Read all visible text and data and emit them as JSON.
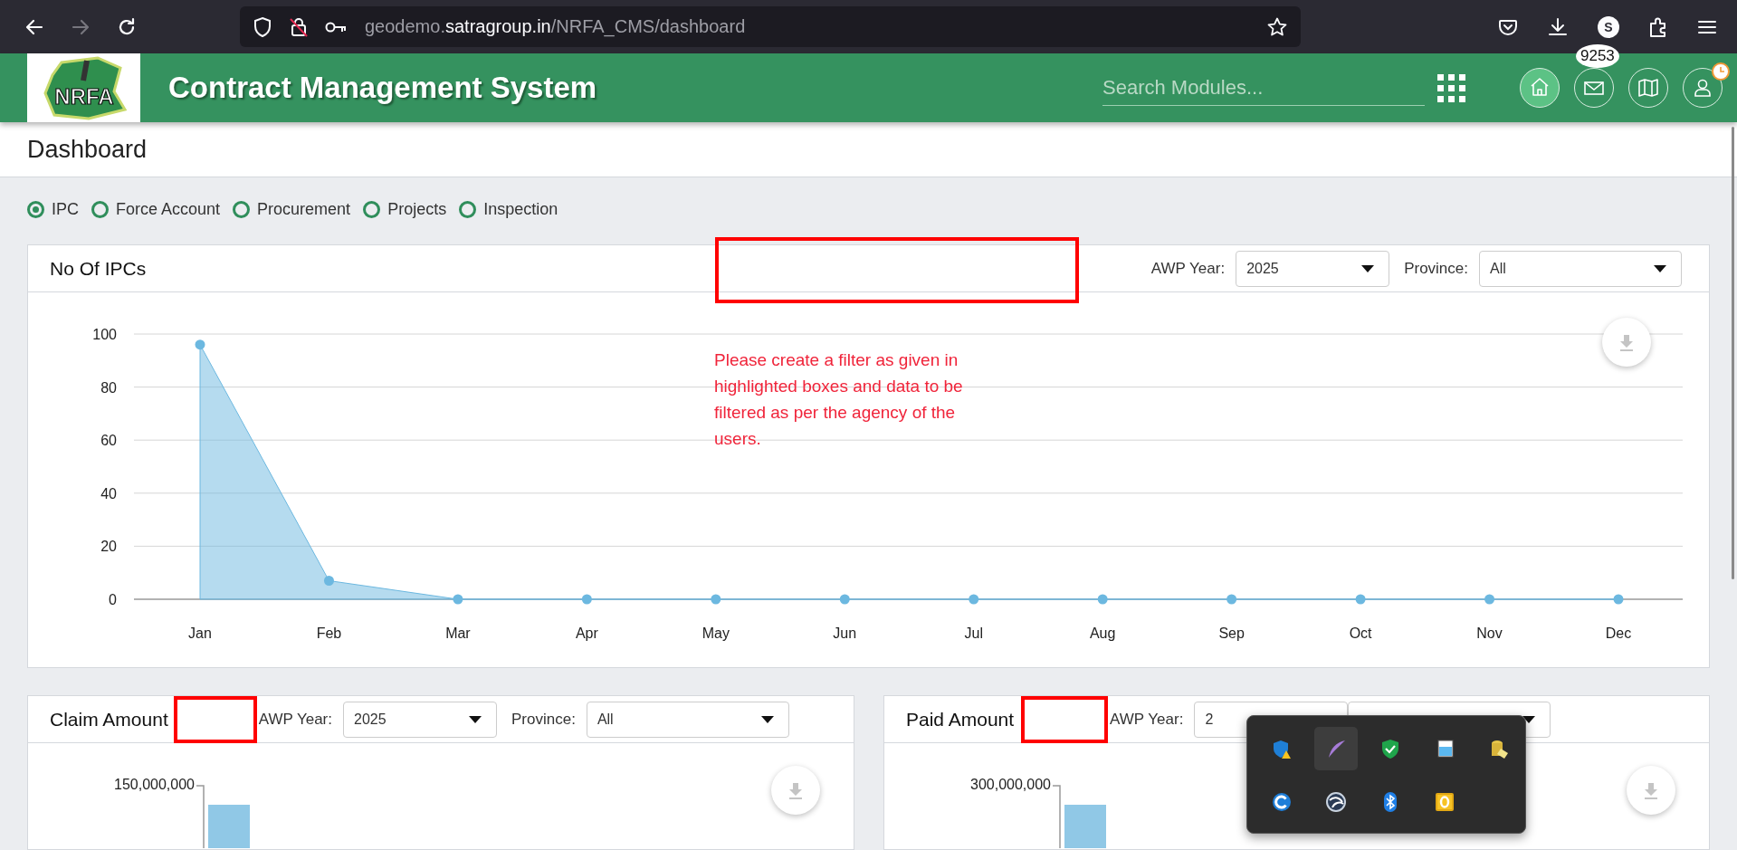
{
  "browser": {
    "nav": [
      {
        "kind": "back",
        "disabled": false
      },
      {
        "kind": "forward",
        "disabled": true
      },
      {
        "kind": "reload",
        "disabled": false
      }
    ],
    "url": {
      "subdomain": "geodemo.",
      "domain": "satragroup.in",
      "path": "/NRFA_CMS/dashboard"
    },
    "profile_initial": "S"
  },
  "header": {
    "logo_text": "NRFA",
    "title": "Contract Management System",
    "search": {
      "placeholder": "Search Modules..."
    },
    "nav_icons": [
      {
        "kind": "home",
        "selected": true
      },
      {
        "kind": "mail",
        "selected": false,
        "badge": "9253"
      },
      {
        "kind": "map",
        "selected": false
      },
      {
        "kind": "user",
        "selected": false,
        "alert": true
      }
    ]
  },
  "page_title": "Dashboard",
  "modules": [
    {
      "label": "IPC",
      "selected": true
    },
    {
      "label": "Force Account",
      "selected": false
    },
    {
      "label": "Procurement",
      "selected": false
    },
    {
      "label": "Projects",
      "selected": false
    },
    {
      "label": "Inspection",
      "selected": false
    }
  ],
  "ipc_card": {
    "title": "No Of IPCs",
    "highlighted": true,
    "filters": [
      {
        "kind": "dropdown",
        "label": "AWP Year:",
        "value": "2025"
      },
      {
        "kind": "dropdown",
        "label": "Province:",
        "value": "All"
      }
    ],
    "note": "Please create a filter as given in highlighted boxes and data to be filtered as per the agency of the users.",
    "chart_data": {
      "type": "area",
      "categories": [
        "Jan",
        "Feb",
        "Mar",
        "Apr",
        "May",
        "Jun",
        "Jul",
        "Aug",
        "Sep",
        "Oct",
        "Nov",
        "Dec"
      ],
      "series": [
        {
          "color": "#6cb8e0",
          "values": [
            96,
            7,
            0,
            0,
            0,
            0,
            0,
            0,
            0,
            0,
            0,
            0
          ]
        }
      ],
      "ylim": [
        0,
        100
      ],
      "yticks": [
        0,
        20,
        40,
        60,
        80,
        100
      ],
      "grid": true
    }
  },
  "amount_cards": [
    {
      "title": "Claim Amount",
      "highlighted": true,
      "filters": [
        {
          "kind": "dropdown",
          "label": "AWP Year:",
          "value": "2025"
        },
        {
          "kind": "dropdown",
          "label": "Province:",
          "value": "All"
        }
      ],
      "y_tick_label": "150,000,000"
    },
    {
      "title": "Paid Amount",
      "highlighted": true,
      "filters": [
        {
          "kind": "dropdown",
          "label": "AWP Year:",
          "value": "2"
        },
        {
          "kind": "dropdown"
        }
      ],
      "y_tick_label": "300,000,000"
    }
  ],
  "tray_popup": {
    "items": [
      {
        "kind": "shield-warning",
        "selected": false
      },
      {
        "kind": "feather",
        "selected": true
      },
      {
        "kind": "shield-check",
        "selected": false
      },
      {
        "kind": "window",
        "selected": false
      },
      {
        "kind": "database",
        "selected": false
      },
      {
        "kind": "sync",
        "selected": false
      },
      {
        "kind": "globe",
        "selected": false
      },
      {
        "kind": "bluetooth",
        "selected": false
      },
      {
        "kind": "office",
        "selected": false
      }
    ]
  }
}
